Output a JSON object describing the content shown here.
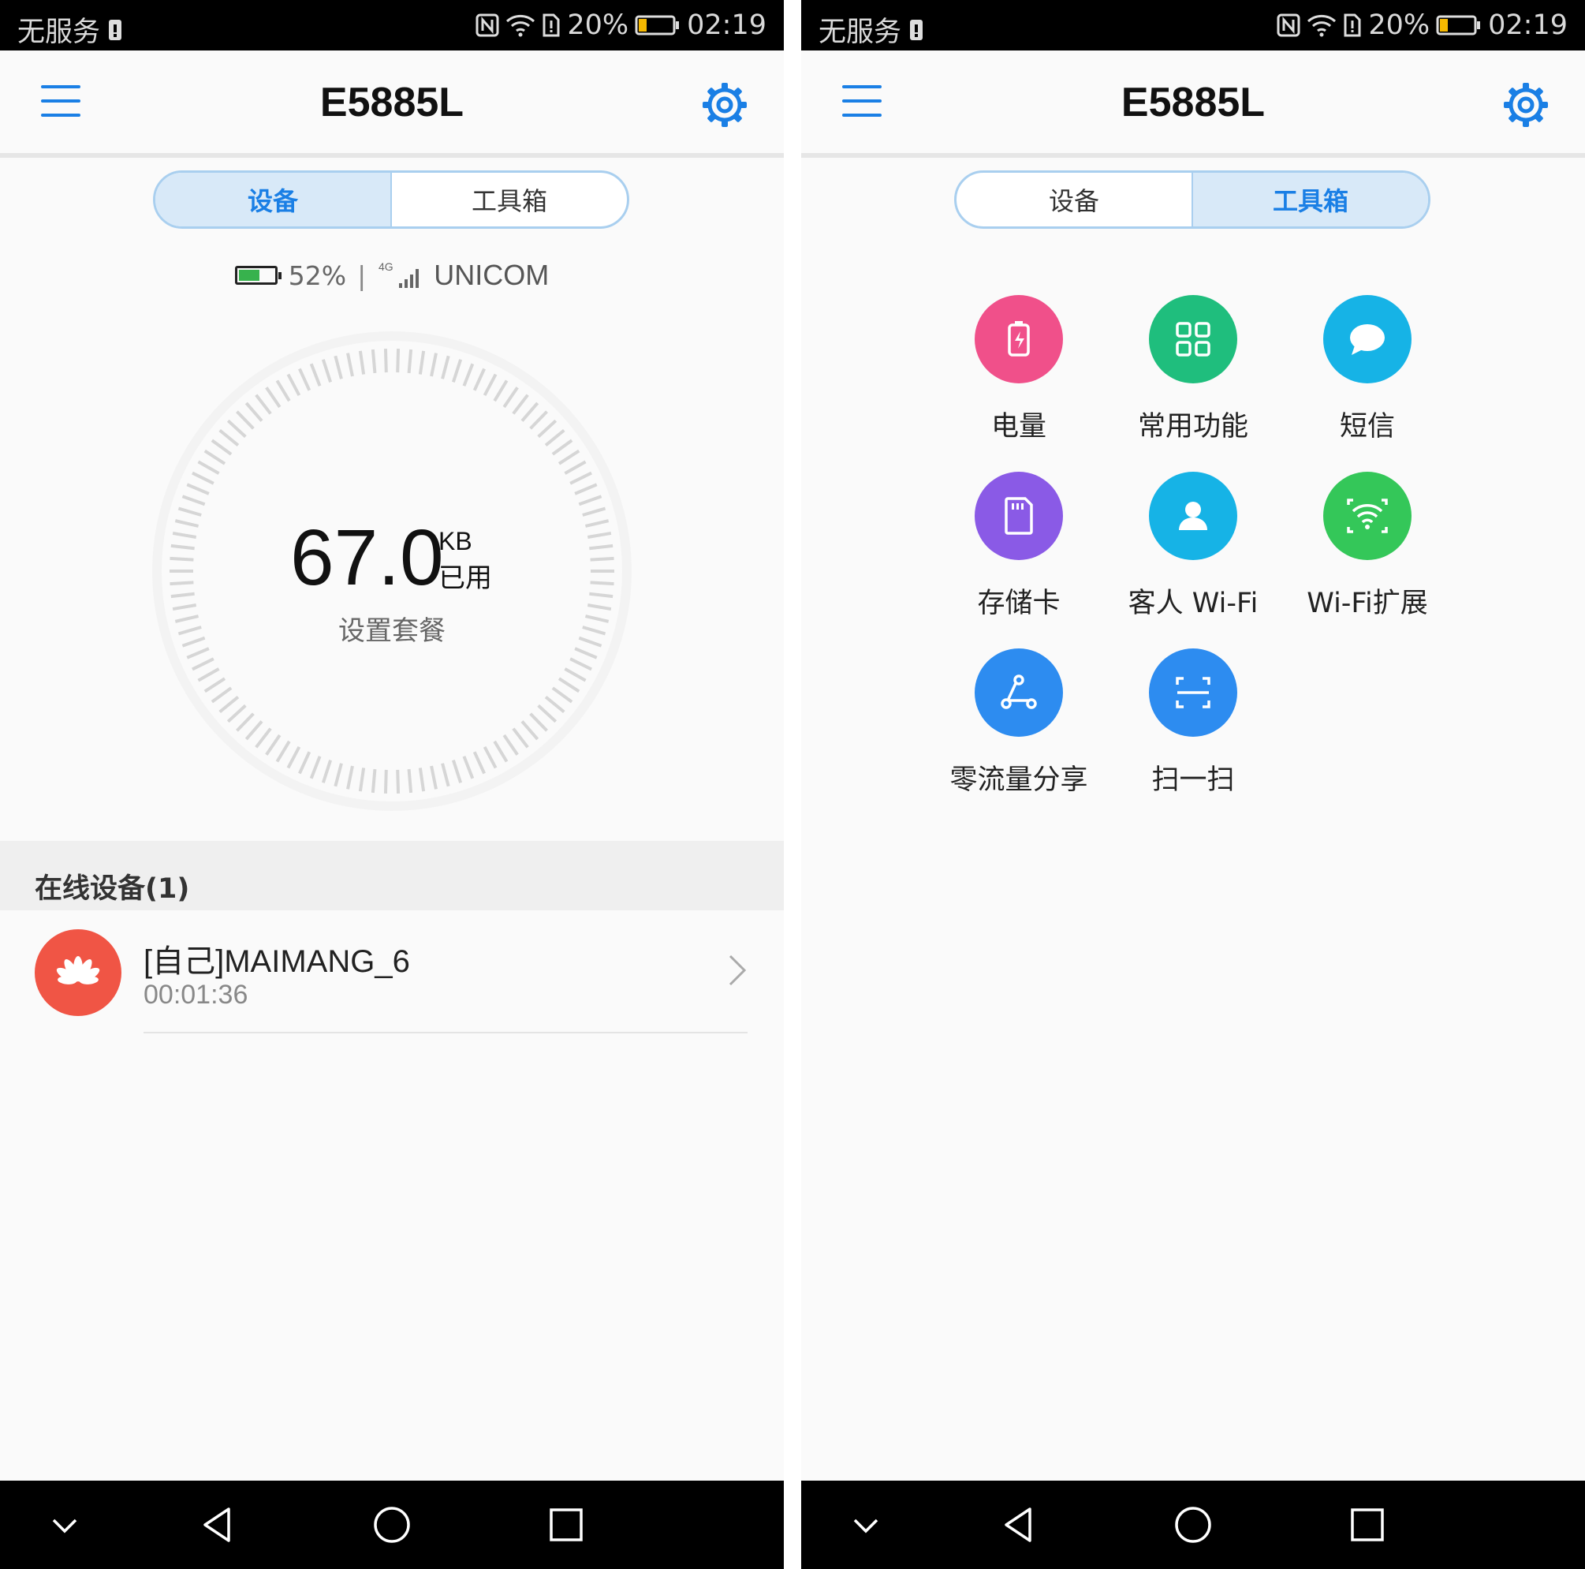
{
  "status_bar": {
    "carrier_text": "无服务",
    "battery_percent": "20%",
    "time": "02:19"
  },
  "app": {
    "title": "E5885L"
  },
  "tabs": {
    "device": "设备",
    "toolbox": "工具箱"
  },
  "device_screen": {
    "battery_percent": "52%",
    "separator": "|",
    "network_type": "4G",
    "carrier": "UNICOM",
    "usage_value": "67.0",
    "usage_unit": "KB",
    "usage_suffix": "已用",
    "set_plan_label": "设置套餐",
    "online_devices_title": "在线设备(1)",
    "devices": [
      {
        "name": "[自己]MAIMANG_6",
        "duration": "00:01:36"
      }
    ]
  },
  "toolbox_screen": {
    "tools": [
      {
        "label": "电量",
        "icon": "battery-icon",
        "color": "#f0508a"
      },
      {
        "label": "常用功能",
        "icon": "grid-icon",
        "color": "#1fbe7d"
      },
      {
        "label": "短信",
        "icon": "message-icon",
        "color": "#16b3e6"
      },
      {
        "label": "存储卡",
        "icon": "sd-card-icon",
        "color": "#8a5ae6"
      },
      {
        "label": "客人 Wi-Fi",
        "icon": "guest-user-icon",
        "color": "#16b3e6"
      },
      {
        "label": "Wi-Fi扩展",
        "icon": "wifi-extend-icon",
        "color": "#34c759"
      },
      {
        "label": "零流量分享",
        "icon": "share-icon",
        "color": "#2d8cf0"
      },
      {
        "label": "扫一扫",
        "icon": "scan-icon",
        "color": "#2d8cf0"
      }
    ]
  },
  "colors": {
    "accent": "#1a7fe5",
    "tab_active_bg": "#d8e9f8"
  }
}
